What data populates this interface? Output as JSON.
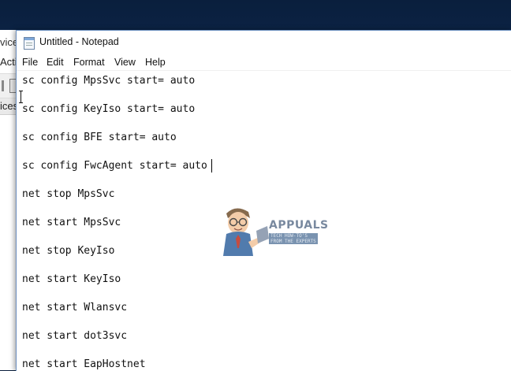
{
  "background_window": {
    "title_fragment": "vice",
    "menu_fragment": "Acti",
    "tree_item_fragment": "ices"
  },
  "notepad": {
    "title": "Untitled - Notepad",
    "menu": [
      "File",
      "Edit",
      "Format",
      "View",
      "Help"
    ],
    "lines": [
      "sc config MpsSvc start= auto",
      "sc config KeyIso start= auto",
      "sc config BFE start= auto",
      "sc config FwcAgent start= auto",
      "net stop MpsSvc",
      "net start MpsSvc",
      "net stop KeyIso",
      "net start KeyIso",
      "net start Wlansvc",
      "net start dot3svc",
      "net start EapHostnet"
    ]
  },
  "watermark": {
    "brand": "APPUALS",
    "tagline": "TECH HOW-TO'S FROM THE EXPERTS"
  },
  "colors": {
    "desktop_top": "#0a1f3d",
    "desktop_bottom": "#0b2447",
    "window_border": "#6b8fbf",
    "text": "#111111"
  }
}
